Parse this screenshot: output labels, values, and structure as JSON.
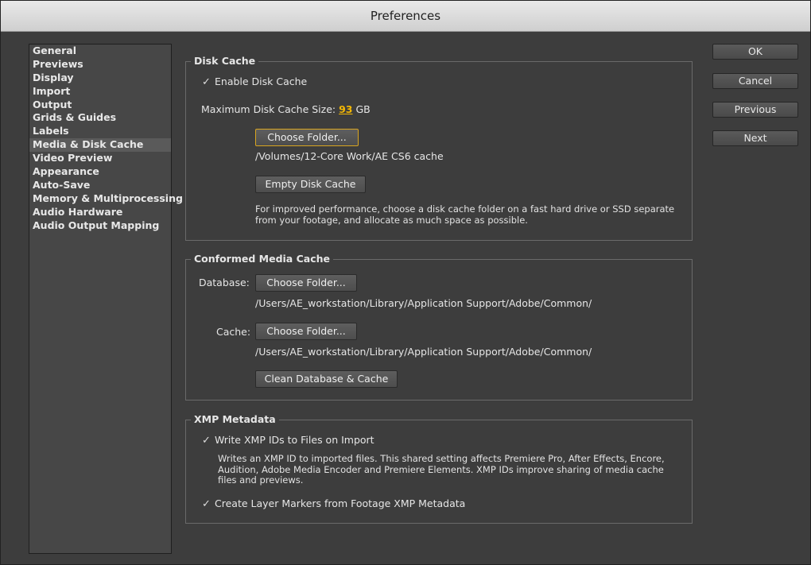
{
  "window": {
    "title": "Preferences"
  },
  "sidebar": {
    "items": [
      {
        "label": "General"
      },
      {
        "label": "Previews"
      },
      {
        "label": "Display"
      },
      {
        "label": "Import"
      },
      {
        "label": "Output"
      },
      {
        "label": "Grids & Guides"
      },
      {
        "label": "Labels"
      },
      {
        "label": "Media & Disk Cache"
      },
      {
        "label": "Video Preview"
      },
      {
        "label": "Appearance"
      },
      {
        "label": "Auto-Save"
      },
      {
        "label": "Memory & Multiprocessing"
      },
      {
        "label": "Audio Hardware"
      },
      {
        "label": "Audio Output Mapping"
      }
    ],
    "selected": "Media & Disk Cache"
  },
  "buttons": {
    "ok": "OK",
    "cancel": "Cancel",
    "previous": "Previous",
    "next": "Next"
  },
  "disk_cache": {
    "legend": "Disk Cache",
    "enable_label": "Enable Disk Cache",
    "enable_checked": true,
    "max_size_label": "Maximum Disk Cache Size:",
    "max_size_value": "93",
    "max_size_unit": "GB",
    "choose_folder": "Choose Folder...",
    "folder_path": "/Volumes/12-Core Work/AE CS6 cache",
    "empty_button": "Empty Disk Cache",
    "note": "For improved performance, choose a disk cache folder on a fast hard drive or SSD separate from your footage, and allocate as much space as possible."
  },
  "conformed_media_cache": {
    "legend": "Conformed Media Cache",
    "database_label": "Database:",
    "database_button": "Choose Folder...",
    "database_path": "/Users/AE_workstation/Library/Application Support/Adobe/Common/",
    "cache_label": "Cache:",
    "cache_button": "Choose Folder...",
    "cache_path": "/Users/AE_workstation/Library/Application Support/Adobe/Common/",
    "clean_button": "Clean Database & Cache"
  },
  "xmp_metadata": {
    "legend": "XMP Metadata",
    "write_ids_label": "Write XMP IDs to Files on Import",
    "write_ids_checked": true,
    "write_ids_desc": "Writes an XMP ID to imported files. This shared setting affects Premiere Pro, After Effects, Encore, Audition, Adobe Media Encoder and Premiere Elements. XMP IDs improve sharing of media cache files and previews.",
    "layer_markers_label": "Create Layer Markers from Footage XMP Metadata",
    "layer_markers_checked": true
  }
}
